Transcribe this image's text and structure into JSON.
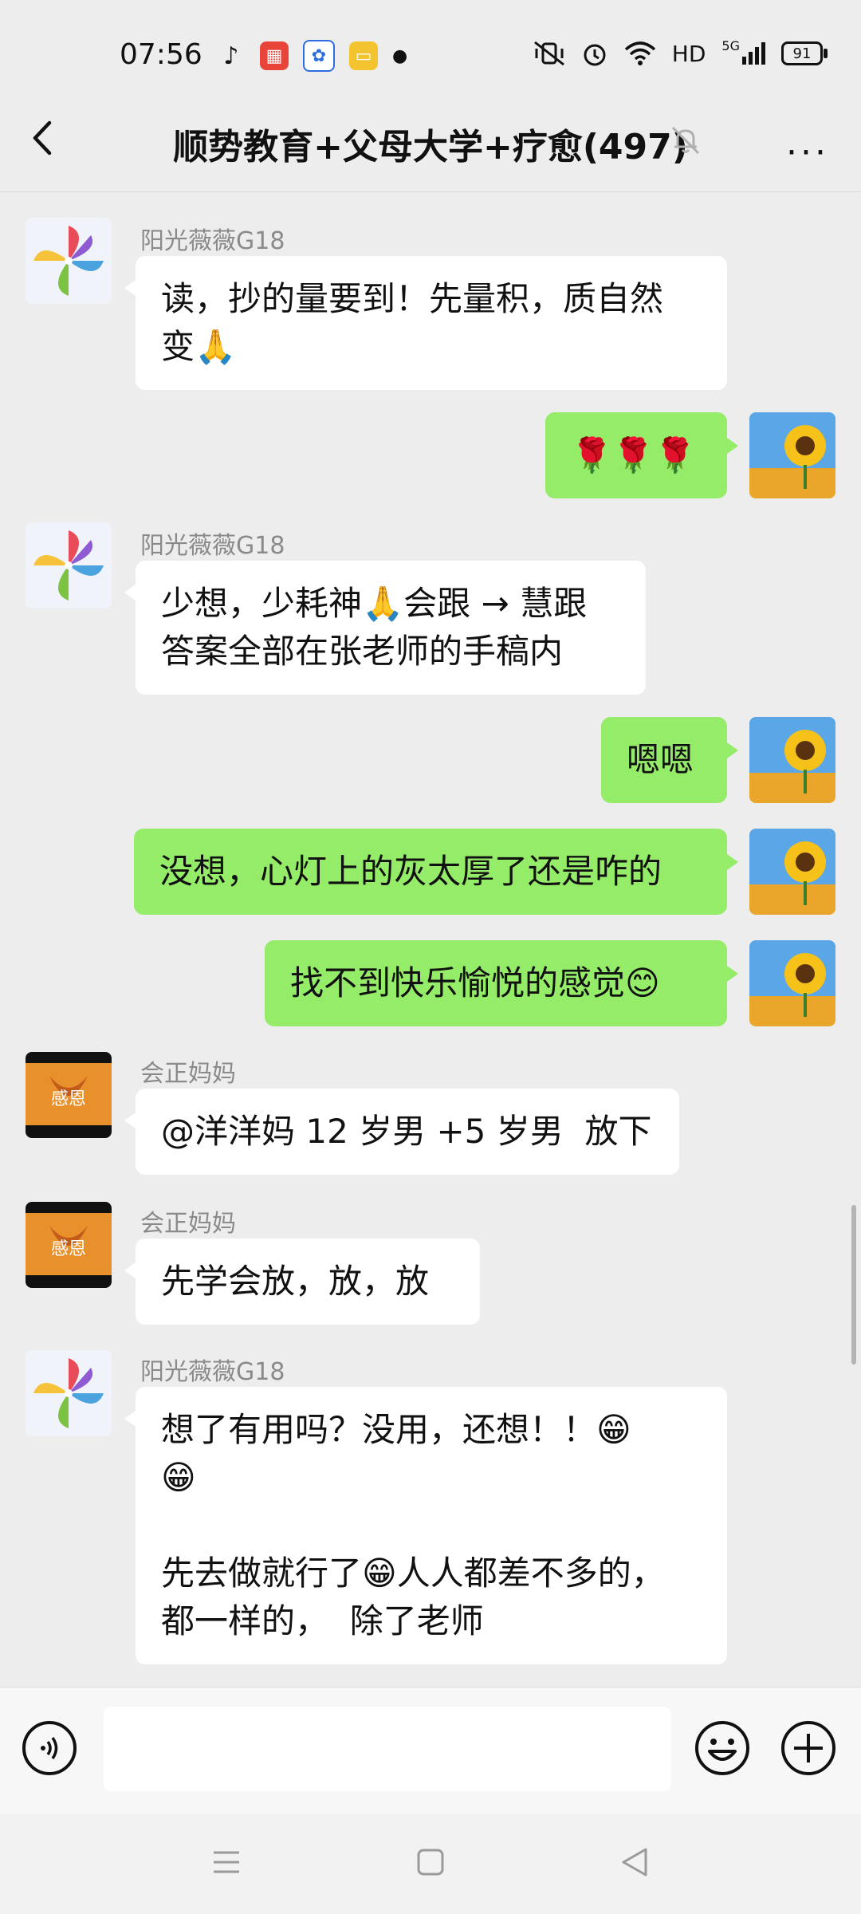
{
  "status_bar": {
    "time": "07:56",
    "network": "HD",
    "signal": "5G",
    "battery": "91"
  },
  "header": {
    "title": "顺势教育+父母大学+疗愈(497)"
  },
  "colors": {
    "background": "#ededed",
    "outgoing_bubble": "#95ec69",
    "incoming_bubble": "#ffffff"
  },
  "messages": [
    {
      "sender": "阳光薇薇G18",
      "text": "读，抄的量要到！先量积，质自然\n变🙏"
    },
    {
      "sender": "",
      "text": "🌹🌹🌹"
    },
    {
      "sender": "阳光薇薇G18",
      "text": "少想，少耗神🙏会跟 → 慧跟\n答案全部在张老师的手稿内"
    },
    {
      "sender": "",
      "text": "嗯嗯"
    },
    {
      "sender": "",
      "text": "没想，心灯上的灰太厚了还是咋的"
    },
    {
      "sender": "",
      "text": "找不到快乐愉悦的感觉😊"
    },
    {
      "sender": "会正妈妈",
      "text": "@洋洋妈 12 岁男 +5 岁男  放下"
    },
    {
      "sender": "会正妈妈",
      "text": "先学会放，放，放"
    },
    {
      "sender": "阳光薇薇G18",
      "text": "想了有用吗？没用，还想！！😁\n😁\n\n先去做就行了😁人人都差不多的，\n都一样的，  除了老师"
    }
  ],
  "avatar_labels": {
    "huizheng": "感恩"
  },
  "icons": {
    "back": "chevron-left-icon",
    "mute": "bell-off-icon",
    "more": "more-dots-icon",
    "voice": "voice-icon",
    "emoji": "emoji-icon",
    "plus": "plus-icon"
  }
}
